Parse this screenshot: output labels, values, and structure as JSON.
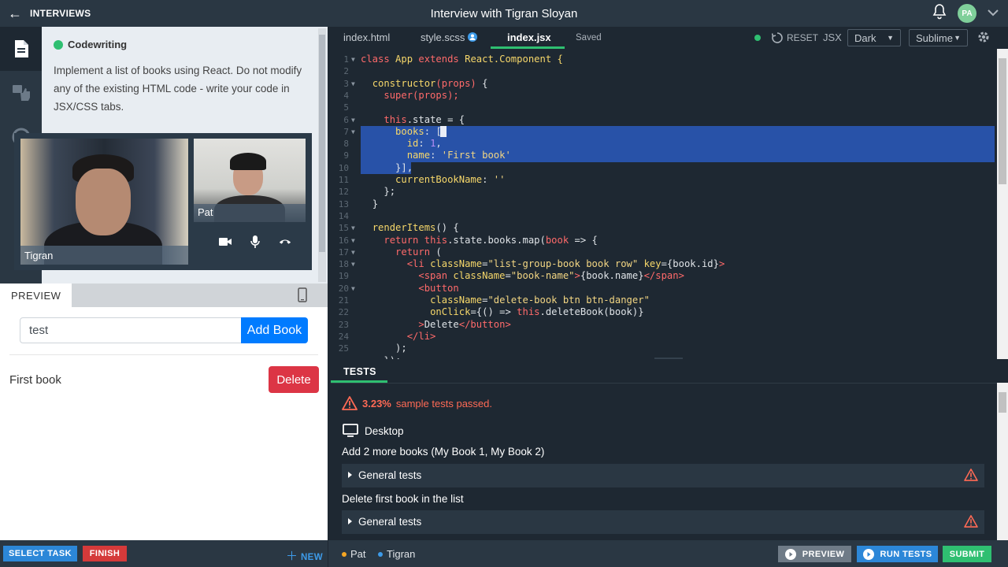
{
  "topbar": {
    "back_label": "INTERVIEWS",
    "title": "Interview with Tigran Sloyan",
    "avatar_initials": "PA"
  },
  "task": {
    "type_label": "Codewriting",
    "description": "Implement a list of books using React. Do not modify any of the existing HTML code - write your code in JSX/CSS tabs."
  },
  "video": {
    "participant_main": "Tigran",
    "participant_small": "Pat"
  },
  "preview": {
    "tab_label": "PREVIEW",
    "input_value": "test",
    "add_button": "Add Book",
    "book_name": "First book",
    "delete_button": "Delete"
  },
  "left_footer": {
    "select_task": "SELECT TASK",
    "finish": "FINISH",
    "new": "NEW"
  },
  "editor": {
    "tabs": [
      {
        "label": "index.html"
      },
      {
        "label": "style.scss"
      },
      {
        "label": "index.jsx"
      }
    ],
    "saved_label": "Saved",
    "reset_label": "RESET",
    "language": "JSX",
    "theme": "Dark",
    "keymap": "Sublime",
    "lines": [
      {
        "n": "1",
        "fold": true
      },
      {
        "n": "2"
      },
      {
        "n": "3",
        "fold": true
      },
      {
        "n": "4"
      },
      {
        "n": "5"
      },
      {
        "n": "6",
        "fold": true
      },
      {
        "n": "7",
        "fold": true
      },
      {
        "n": "8"
      },
      {
        "n": "9"
      },
      {
        "n": "10"
      },
      {
        "n": "11"
      },
      {
        "n": "12"
      },
      {
        "n": "13"
      },
      {
        "n": "14"
      },
      {
        "n": "15",
        "fold": true
      },
      {
        "n": "16",
        "fold": true
      },
      {
        "n": "17",
        "fold": true
      },
      {
        "n": "18",
        "fold": true
      },
      {
        "n": "19"
      },
      {
        "n": "20",
        "fold": true
      },
      {
        "n": "21"
      },
      {
        "n": "22"
      },
      {
        "n": "23"
      },
      {
        "n": "24"
      },
      {
        "n": "25"
      }
    ],
    "code": {
      "l1a": "class",
      "l1b": "App",
      "l1c": "extends",
      "l1d": "React.Component {",
      "l3a": "constructor",
      "l3b": "(props)",
      "l3c": " {",
      "l4a": "super",
      "l4b": "(props);",
      "l6a": "this",
      "l6b": ".state = {",
      "l7a": "books",
      "l7b": ": [",
      "l8a": "id",
      "l8b": ": ",
      "l8c": "1",
      "l8d": ",",
      "l9a": "name",
      "l9b": ": ",
      "l9c": "'First book'",
      "l10a": "}],",
      "l11a": "currentBookName",
      "l11b": ": ",
      "l11c": "''",
      "l12a": "};",
      "l13a": "}",
      "l15a": "renderItems",
      "l15b": "() {",
      "l16a": "return",
      "l16b": "this",
      "l16c": ".state.books.map(",
      "l16d": "book",
      "l16e": " => {",
      "l17a": "return",
      "l17b": " (",
      "l18a": "<li",
      "l18b": "className",
      "l18c": "=",
      "l18d": "\"list-group-book book row\"",
      "l18e": "key",
      "l18f": "={book.id}",
      "l18g": ">",
      "l19a": "<span",
      "l19b": "className",
      "l19c": "=",
      "l19d": "\"book-name\"",
      "l19e": ">",
      "l19f": "{book.name}",
      "l19g": "</span>",
      "l20a": "<button",
      "l21a": "className",
      "l21b": "=",
      "l21c": "\"delete-book btn btn-danger\"",
      "l22a": "onClick",
      "l22b": "={() => ",
      "l22c": "this",
      "l22d": ".deleteBook(book)}",
      "l23a": ">",
      "l23b": "Delete",
      "l23c": "</button>",
      "l24a": "</li>",
      "l25a": ");",
      "l26a": "});"
    }
  },
  "tests": {
    "tab_label": "TESTS",
    "percent": "3.23%",
    "passed_label": "sample tests passed.",
    "device": "Desktop",
    "items": [
      {
        "description": "Add 2 more books (My Book 1, My Book 2)",
        "group": "General tests"
      },
      {
        "description": "Delete first book in the list",
        "group": "General tests"
      }
    ]
  },
  "right_footer": {
    "users": [
      {
        "name": "Pat",
        "color": "#f5a623"
      },
      {
        "name": "Tigran",
        "color": "#3d9be9"
      }
    ],
    "preview_button": "PREVIEW",
    "run_tests_button": "RUN TESTS",
    "submit_button": "SUBMIT"
  },
  "colors": {
    "accent_green": "#2fbf71",
    "primary_blue": "#007bff",
    "danger_red": "#dc3545",
    "selection": "#2852a8"
  }
}
